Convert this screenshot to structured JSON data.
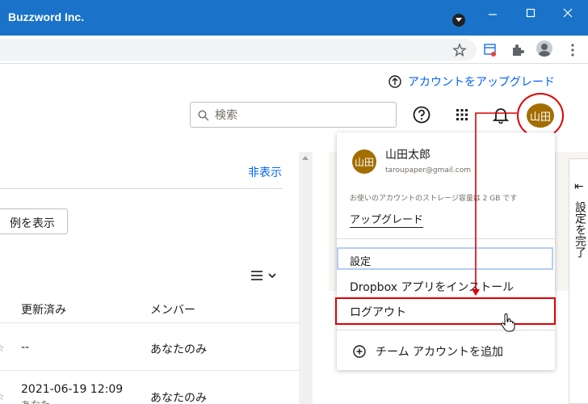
{
  "window": {
    "title": "Buzzword Inc."
  },
  "header": {
    "upgrade_link": "アカウントをアップグレード",
    "search_placeholder": "検索",
    "avatar_initials": "山田"
  },
  "content": {
    "hide_link": "非表示",
    "show_examples_button": "例を表示",
    "columns": {
      "modified": "更新済み",
      "members": "メンバー"
    },
    "rows": [
      {
        "modified": "--",
        "members": "あなたのみ"
      },
      {
        "modified": "2021-06-19 12:09",
        "modified_sub": "あなた",
        "members": "あなたのみ"
      }
    ]
  },
  "side_panel": {
    "label": "設定を完了"
  },
  "account_menu": {
    "avatar_initials": "山田",
    "user_name": "山田太郎",
    "email": "taroupaper@gmail.com",
    "storage_text": "お使いのアカウントのストレージ容量は 2 GB です",
    "upgrade": "アップグレード",
    "settings": "設定",
    "install_app": "Dropbox アプリをインストール",
    "logout": "ログアウト",
    "add_team_account": "チーム アカウントを追加"
  },
  "colors": {
    "titlebar": "#1a73c9",
    "link": "#0061fe",
    "avatar": "#a36e00",
    "highlight": "#e00000"
  },
  "icons": [
    "chevron-down-icon",
    "minimize-icon",
    "maximize-icon",
    "close-icon",
    "star-icon",
    "extension-icon",
    "puzzle-icon",
    "profile-icon",
    "kebab-menu-icon",
    "upgrade-arrow-icon",
    "search-icon",
    "help-icon",
    "app-grid-icon",
    "bell-icon",
    "list-view-icon",
    "collapse-arrow-icon",
    "plus-circle-icon",
    "hand-cursor-icon"
  ]
}
